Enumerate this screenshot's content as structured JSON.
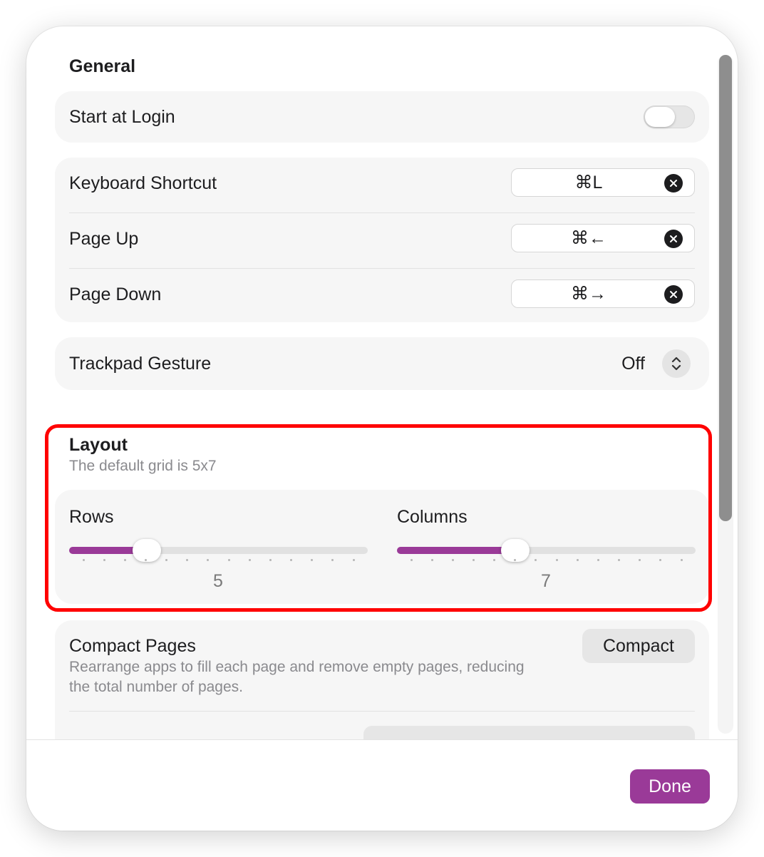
{
  "colors": {
    "accent": "#9a3a98",
    "highlight_outline": "#ff0000"
  },
  "general": {
    "title": "General",
    "start_at_login": {
      "label": "Start at Login",
      "enabled": false
    },
    "shortcuts": [
      {
        "label": "Keyboard Shortcut",
        "value": "⌘L",
        "clear_icon": "x-circle-icon"
      },
      {
        "label": "Page Up",
        "value": "⌘←",
        "clear_icon": "x-circle-icon"
      },
      {
        "label": "Page Down",
        "value": "⌘→",
        "clear_icon": "x-circle-icon"
      }
    ],
    "trackpad_gesture": {
      "label": "Trackpad Gesture",
      "value": "Off",
      "icon": "up-down-chevron-icon"
    }
  },
  "layout": {
    "title": "Layout",
    "subtitle": "The default grid is 5x7",
    "rows": {
      "label": "Rows",
      "value": "5",
      "level": 0.26,
      "ticks": 14
    },
    "columns": {
      "label": "Columns",
      "value": "7",
      "level": 0.395,
      "ticks": 14
    }
  },
  "compact_pages": {
    "label": "Compact Pages",
    "description": "Rearrange apps to fill each page and remove empty pages, reducing the total number of pages.",
    "button_label": "Compact"
  },
  "footer": {
    "done_label": "Done"
  }
}
